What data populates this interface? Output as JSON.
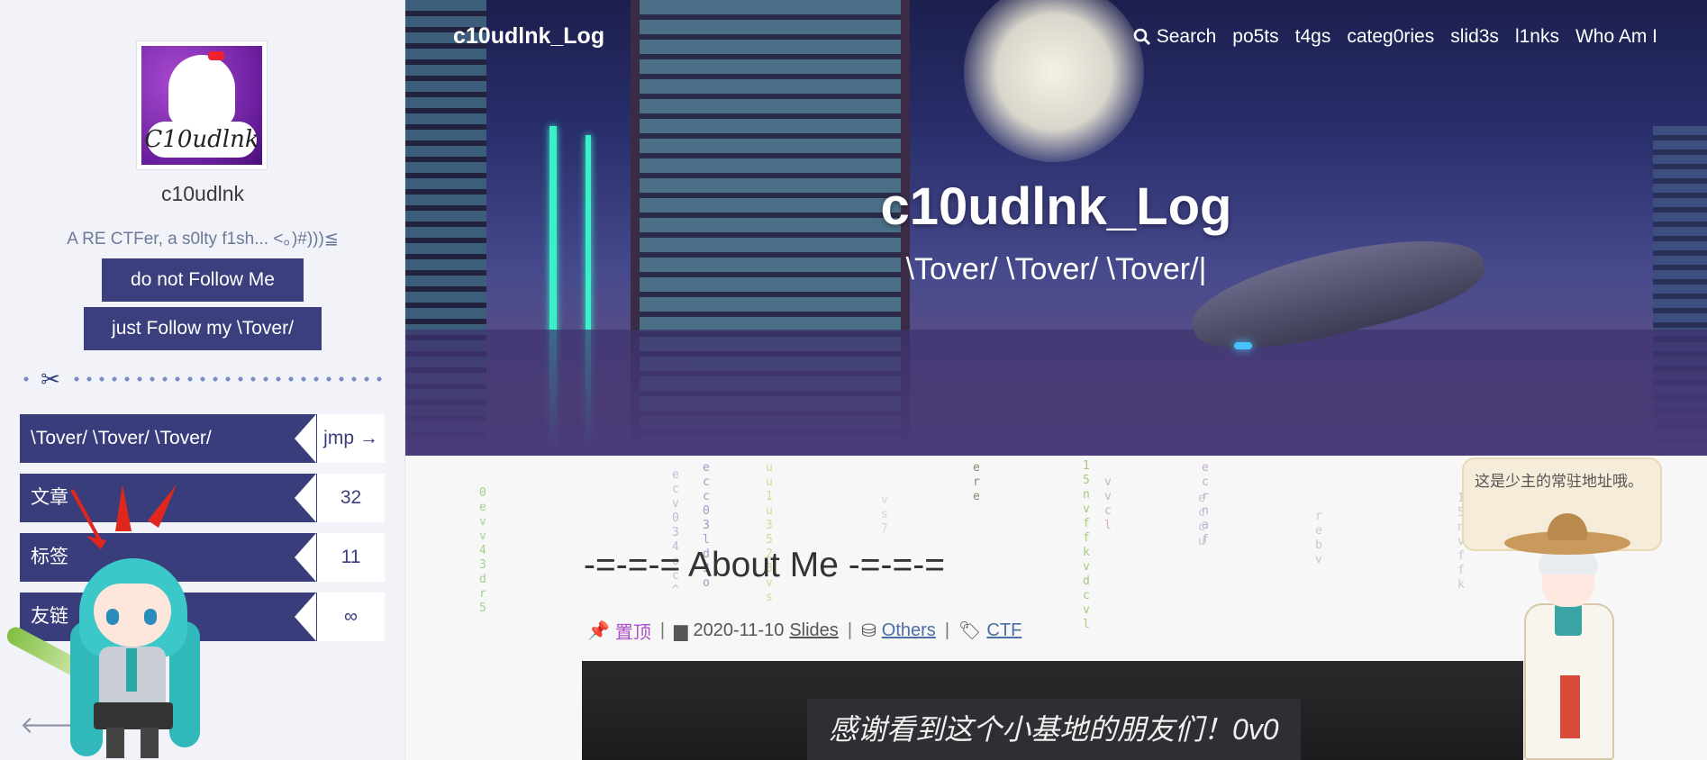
{
  "sidebar": {
    "author": "c10udlnk",
    "description": "A RE CTFer, a s0lty f1sh... <。)#)))≦",
    "avatar_text": "C10udlnk",
    "buttons": {
      "no_follow": "do not Follow Me",
      "follow": "just Follow my \\Tover/"
    },
    "stats": [
      {
        "label": "\\Tover/ \\Tover/ \\Tover/",
        "value": "jmp →"
      },
      {
        "label": "文章",
        "value": "32"
      },
      {
        "label": "标签",
        "value": "11"
      },
      {
        "label": "友链",
        "value": "∞"
      }
    ],
    "back_arrow": "🡐"
  },
  "header": {
    "brand": "c10udlnk_Log",
    "nav": {
      "search": "Search",
      "items": [
        "po5ts",
        "t4gs",
        "categ0ries",
        "slid3s",
        "l1nks",
        "Who Am I"
      ]
    },
    "title": "c10udlnk_Log",
    "subtitle": "\\Tover/ \\Tover/ \\Tover/|"
  },
  "post": {
    "title": "-=-=-= About Me -=-=-=",
    "pinned": "置顶",
    "date": "2020-11-10",
    "slides": "Slides",
    "category": "Others",
    "tag": "CTF",
    "banner_text": "感谢看到这个小基地的朋友们！0v0"
  },
  "mascot": {
    "bubble_text": "这是少主的常驻地址哦。"
  },
  "matrix_columns": [
    "0evv43dr5",
    "ecv034oc^",
    "ecc03ld3o",
    "uu1u3523vs",
    "vs7",
    "ere",
    "15nvffkvdcvl",
    "vvcl",
    "eccu",
    "ecrnaf",
    "rebv",
    "15nvffk"
  ],
  "colors": {
    "accent": "#3b3f7e",
    "pin": "#b04ec9",
    "link": "#4c6ea4"
  }
}
